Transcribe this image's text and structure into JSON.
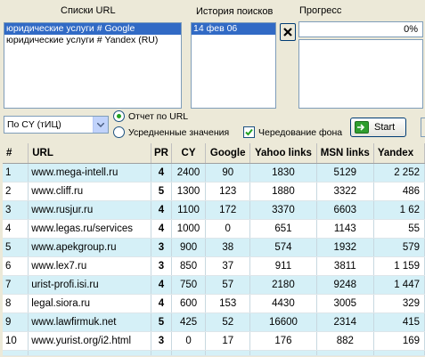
{
  "panels": {
    "url_lists_label": "Списки URL",
    "history_label": "История поисков",
    "progress_label": "Прогресс"
  },
  "url_lists": [
    {
      "label": "юридические услуги # Google",
      "selected": true
    },
    {
      "label": "юридические услуги # Yandex (RU)",
      "selected": false
    }
  ],
  "history": [
    {
      "label": "14 фев 06",
      "selected": true
    }
  ],
  "progress": {
    "text": "0%",
    "value": 0
  },
  "controls": {
    "sort_select_value": "По CY (тИЦ)",
    "radio_report_by_url": "Отчет по URL",
    "radio_averaged": "Усредненные значения",
    "checkbox_alternating": "Чередование фона",
    "start_label": "Start"
  },
  "table": {
    "headers": [
      "#",
      "URL",
      "PR",
      "CY",
      "Google",
      "Yahoo links",
      "MSN links",
      "Yandex"
    ],
    "rows": [
      [
        "1",
        "www.mega-intell.ru",
        "4",
        "2400",
        "90",
        "1830",
        "5129",
        "2 252"
      ],
      [
        "2",
        "www.cliff.ru",
        "5",
        "1300",
        "123",
        "1880",
        "3322",
        "486"
      ],
      [
        "3",
        "www.rusjur.ru",
        "4",
        "1100",
        "172",
        "3370",
        "6603",
        "1 62"
      ],
      [
        "4",
        "www.legas.ru/services",
        "4",
        "1000",
        "0",
        "651",
        "1143",
        "55"
      ],
      [
        "5",
        "www.apekgroup.ru",
        "3",
        "900",
        "38",
        "574",
        "1932",
        "579"
      ],
      [
        "6",
        "www.lex7.ru",
        "3",
        "850",
        "37",
        "911",
        "3811",
        "1 159"
      ],
      [
        "7",
        "urist-profi.isi.ru",
        "4",
        "750",
        "57",
        "2180",
        "9248",
        "1 447"
      ],
      [
        "8",
        "legal.siora.ru",
        "4",
        "600",
        "153",
        "4430",
        "3005",
        "329"
      ],
      [
        "9",
        "www.lawfirmuk.net",
        "5",
        "425",
        "52",
        "16600",
        "2314",
        "415"
      ],
      [
        "10",
        "www.yurist.org/i2.html",
        "3",
        "0",
        "17",
        "176",
        "882",
        "169"
      ]
    ]
  },
  "colors": {
    "alt_row": "#d5f0f7",
    "selection": "#316ac5",
    "window_bg": "#ece9d8"
  }
}
